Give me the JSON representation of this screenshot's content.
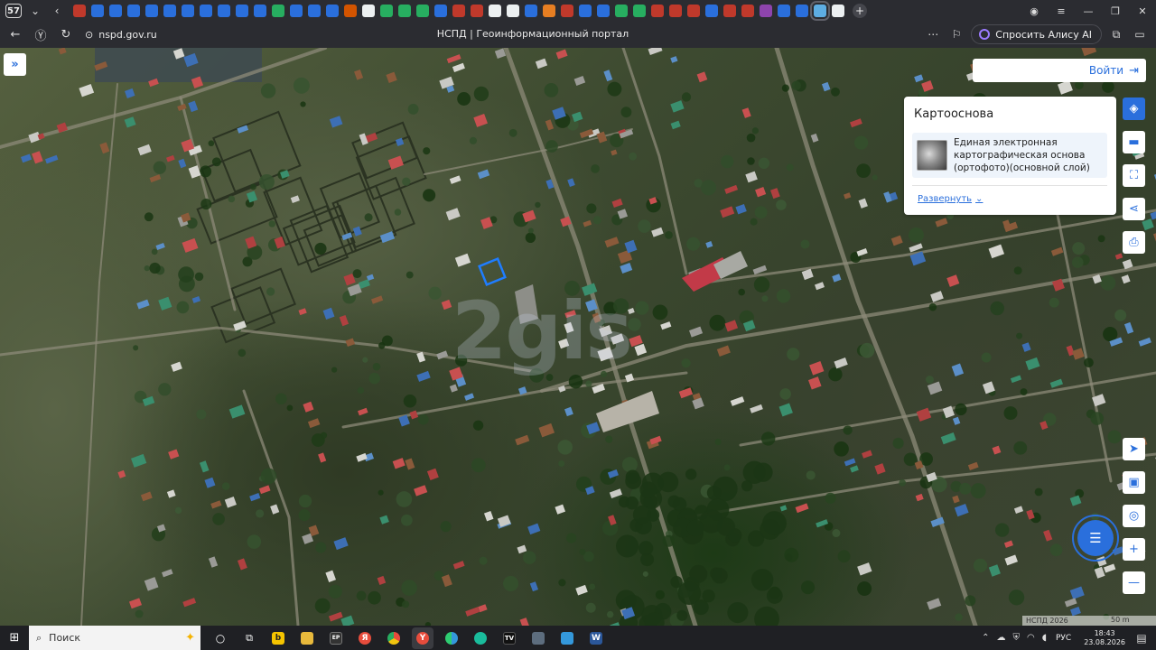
{
  "browser": {
    "tab_count": "57",
    "url": "nspd.gov.ru",
    "page_title": "НСПД | Геоинформационный портал",
    "alice_label": "Спросить Алису AI",
    "favicons": [
      "#c0392b",
      "#2a6fdc",
      "#2a6fdc",
      "#2a6fdc",
      "#2a6fdc",
      "#2a6fdc",
      "#2a6fdc",
      "#2a6fdc",
      "#2a6fdc",
      "#2a6fdc",
      "#2a6fdc",
      "#27ae60",
      "#2a6fdc",
      "#2a6fdc",
      "#2a6fdc",
      "#d35400",
      "#ecf0f1",
      "#27ae60",
      "#27ae60",
      "#27ae60",
      "#2a6fdc",
      "#c0392b",
      "#c0392b",
      "#ecf0f1",
      "#ecf0f1",
      "#2a6fdc",
      "#e67e22",
      "#c0392b",
      "#2a6fdc",
      "#2a6fdc",
      "#27ae60",
      "#27ae60",
      "#c0392b",
      "#c0392b",
      "#c0392b",
      "#2a6fdc",
      "#c0392b",
      "#c0392b",
      "#8e44ad",
      "#2a6fdc",
      "#2a6fdc",
      "#5dade2",
      "#ecf0f1"
    ]
  },
  "map": {
    "watermark": "2gis",
    "login_label": "Войти",
    "panel": {
      "title": "Картооснова",
      "layer_name": "Единая электронная картографическая основа (ортофото)(основной слой)",
      "expand_label": "Развернуть"
    },
    "attribution": "НСПД 2026",
    "scale": "50 m",
    "accent_color": "#2a6fdc"
  },
  "taskbar": {
    "search_label": "Поиск",
    "lang": "РУС",
    "time": "18:43",
    "date": "23.08.2026"
  }
}
